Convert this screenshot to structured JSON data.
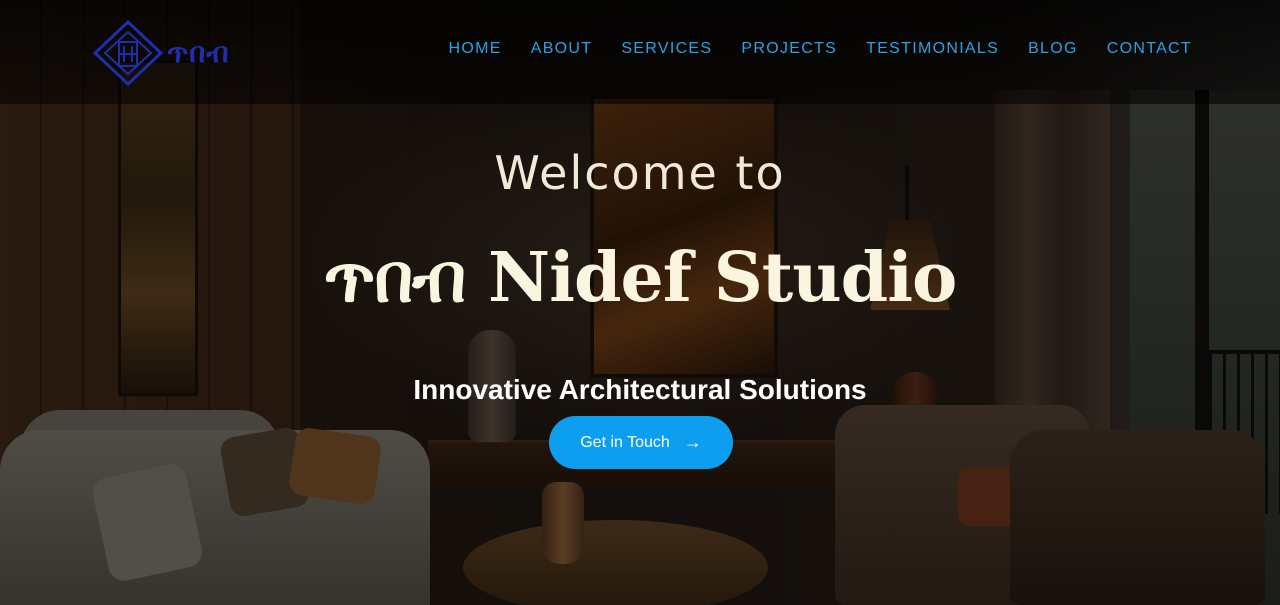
{
  "brand": {
    "logo_text": "ጥበብ",
    "logo_icon": "diamond-emblem-icon",
    "logo_color": "#1e2fae"
  },
  "nav": {
    "items": [
      {
        "label": "HOME"
      },
      {
        "label": "ABOUT"
      },
      {
        "label": "SERVICES"
      },
      {
        "label": "PROJECTS"
      },
      {
        "label": "TESTIMONIALS"
      },
      {
        "label": "BLOG"
      },
      {
        "label": "CONTACT"
      }
    ],
    "color": "#2aa3e6"
  },
  "hero": {
    "welcome": "Welcome to",
    "title": "ጥበብ Nidef Studio",
    "tagline": "Innovative Architectural Solutions",
    "cta_label": "Get in Touch",
    "cta_icon": "arrow-right-icon",
    "cta_arrow": "→",
    "cta_color": "#0d9ef0"
  }
}
